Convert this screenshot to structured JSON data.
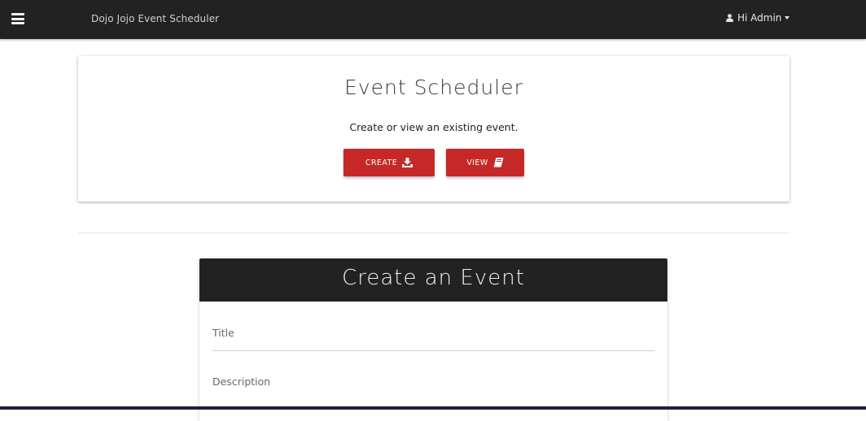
{
  "navbar": {
    "brand": "Dojo Jojo Event Scheduler",
    "user_greeting": "Hi Admin"
  },
  "scheduler_card": {
    "title": "Event Scheduler",
    "subtitle": "Create or view an existing event.",
    "create_label": "CREATE",
    "view_label": "VIEW"
  },
  "create_form": {
    "heading": "Create an Event",
    "fields": [
      {
        "placeholder": "Title",
        "value": ""
      },
      {
        "placeholder": "Description",
        "value": ""
      }
    ]
  },
  "colors": {
    "navbar_bg": "#222222",
    "button_red": "#c62828",
    "form_header_bg": "#222222"
  },
  "icons": {
    "menu": "hamburger-menu-icon",
    "user": "user-icon",
    "create": "download-icon",
    "view": "book-icon"
  }
}
